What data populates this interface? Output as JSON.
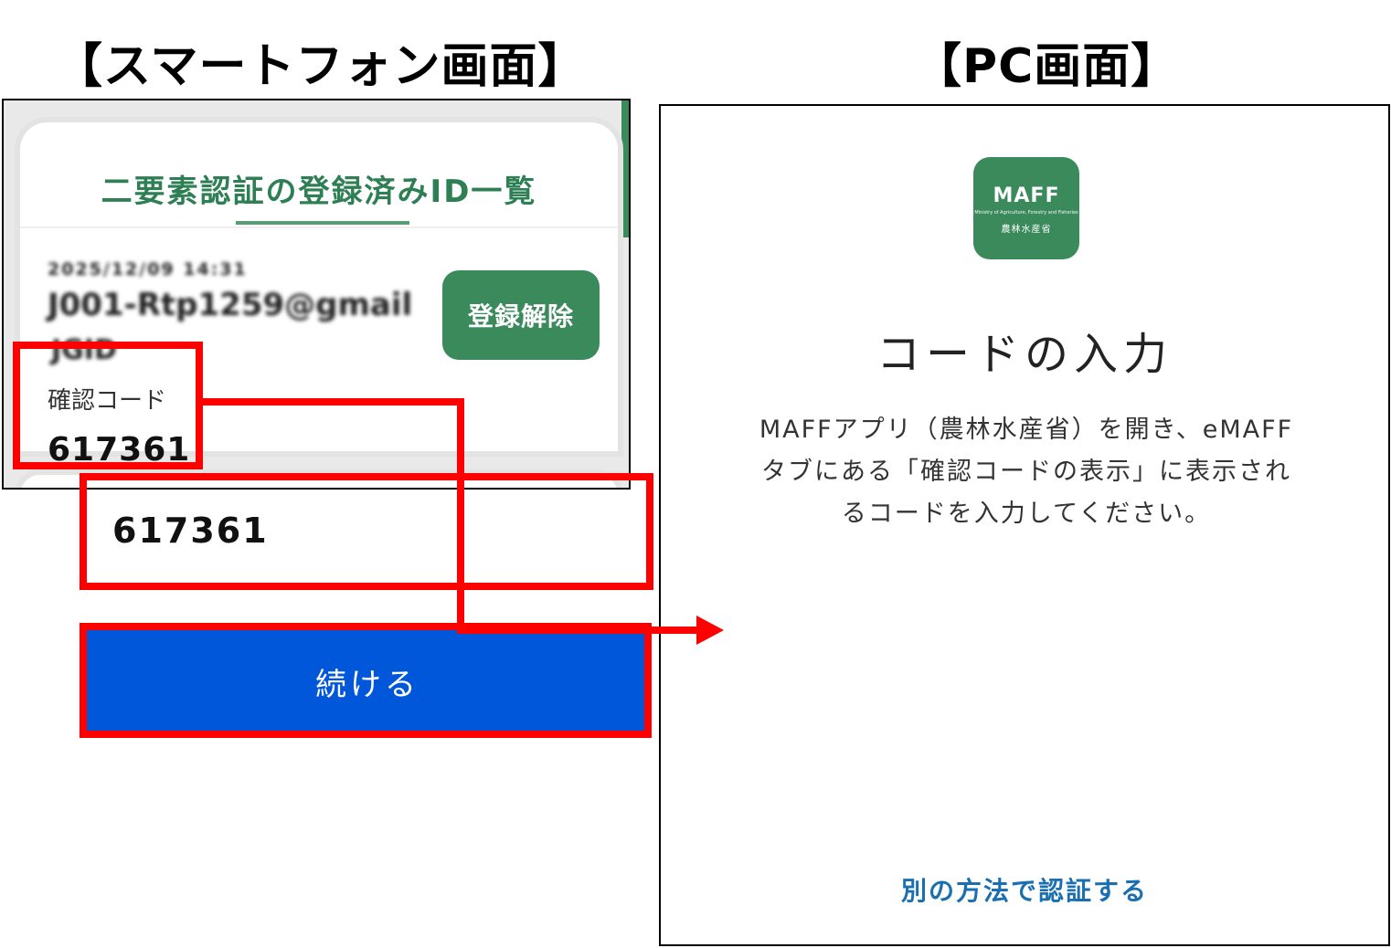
{
  "headings": {
    "smartphone": "【スマートフォン画面】",
    "pc": "【PC画面】"
  },
  "smartphone": {
    "title": "二要素認証の登録済みID一覧",
    "blurred_line_1": "2025/12/09 14:31",
    "blurred_line_2": "J001-Rtp1259@gmail",
    "blurred_line_3": "JGID",
    "unregister_button": "登録解除",
    "confirm_code_label": "確認コード",
    "confirm_code_value": "617361"
  },
  "pc": {
    "logo": {
      "name": "MAFF",
      "subtitle": "Ministry of Agriculture, Forestry and Fisheries",
      "japanese": "農林水産省"
    },
    "title": "コードの入力",
    "description_lines": [
      "MAFFアプリ（農林水産省）を開き、eMAFF",
      "タブにある「確認コードの表示」に表示され",
      "るコードを入力してください。"
    ],
    "code_input_value": "617361",
    "continue_button": "続ける",
    "alternate_link": "別の方法で認証する"
  },
  "colors": {
    "maff_green": "#3b8a5c",
    "highlight_red": "#ff0000",
    "primary_blue": "#0057da",
    "link_blue": "#1a6fb0"
  }
}
